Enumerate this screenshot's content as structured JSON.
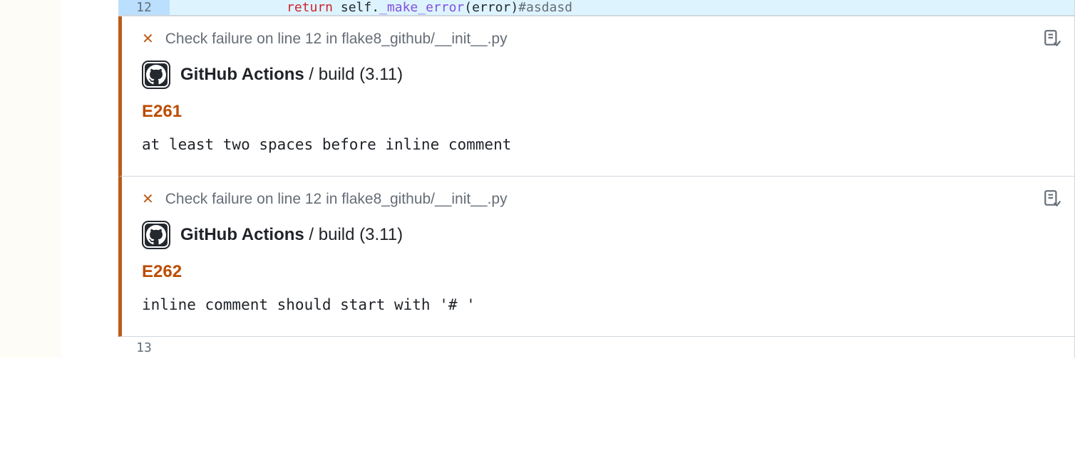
{
  "code_line": {
    "number": "12",
    "tokens": {
      "return": "return",
      "self": " self",
      "dot": ".",
      "func": "_make_error",
      "paren_open": "(",
      "arg": "error",
      "paren_close": ")",
      "comment": "#asdasd"
    }
  },
  "annotations": [
    {
      "failure_text": "Check failure on line 12 in flake8_github/__init__.py",
      "workflow": "GitHub Actions",
      "separator": " / ",
      "job": "build (3.11)",
      "error_code": "E261",
      "error_message": "at least two spaces before inline comment"
    },
    {
      "failure_text": "Check failure on line 12 in flake8_github/__init__.py",
      "workflow": "GitHub Actions",
      "separator": " / ",
      "job": "build (3.11)",
      "error_code": "E262",
      "error_message": "inline comment should start with '# '"
    }
  ],
  "next_line_number": "13"
}
